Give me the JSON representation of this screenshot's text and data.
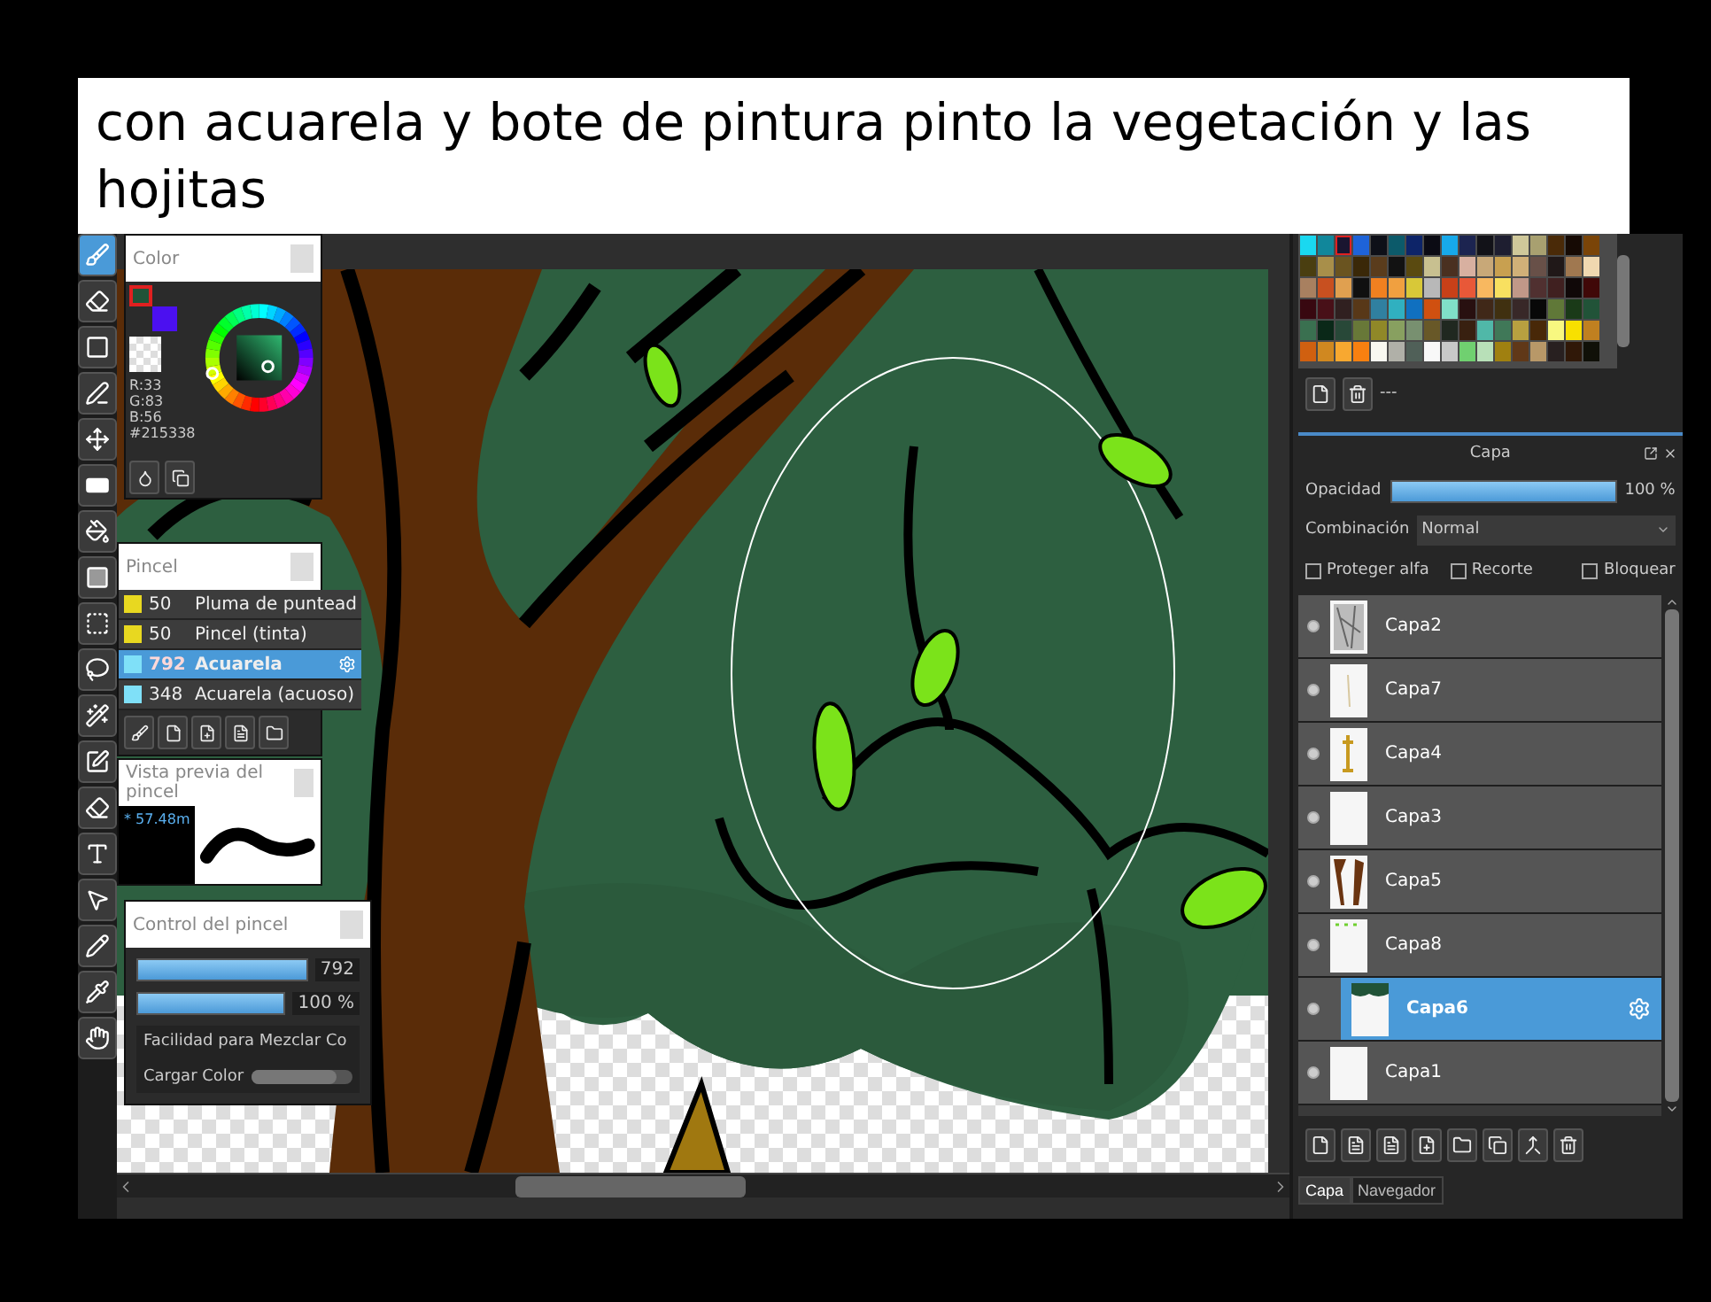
{
  "caption": "con acuarela y bote de pintura pinto  la vegetación y las hojitas",
  "tools": [
    {
      "kind": "brush",
      "selected": true
    },
    {
      "kind": "eraser",
      "selected": false
    },
    {
      "kind": "rect",
      "selected": false
    },
    {
      "kind": "pen",
      "selected": false
    },
    {
      "kind": "move",
      "selected": false
    },
    {
      "kind": "fill-rect",
      "selected": false
    },
    {
      "kind": "bucket",
      "selected": false
    },
    {
      "kind": "gradient",
      "selected": false
    },
    {
      "kind": "select",
      "selected": false
    },
    {
      "kind": "lasso",
      "selected": false
    },
    {
      "kind": "wand",
      "selected": false
    },
    {
      "kind": "select-pen",
      "selected": false
    },
    {
      "kind": "select-eraser",
      "selected": false
    },
    {
      "kind": "text",
      "selected": false
    },
    {
      "kind": "operation",
      "selected": false
    },
    {
      "kind": "divide",
      "selected": false
    },
    {
      "kind": "eyedropper",
      "selected": false
    },
    {
      "kind": "hand",
      "selected": false
    }
  ],
  "color_panel": {
    "title": "Color",
    "values": [
      "R:33",
      "G:83",
      "B:56"
    ],
    "hex": "#215338"
  },
  "brush_panel": {
    "title": "Pincel",
    "brushes": [
      {
        "size": "50",
        "name": "Pluma de puntead",
        "color": "#e8d820",
        "selected": false
      },
      {
        "size": "50",
        "name": "Pincel (tinta)",
        "color": "#e8d820",
        "selected": false
      },
      {
        "size": "792",
        "name": "Acuarela",
        "color": "#7fe0f8",
        "selected": true
      },
      {
        "size": "348",
        "name": "Acuarela (acuoso)",
        "color": "#7fe0f8",
        "selected": false
      }
    ]
  },
  "preview_panel": {
    "title": "Vista previa del pincel",
    "size": "* 57.48m"
  },
  "control_panel": {
    "title": "Control del pincel",
    "sliders": [
      {
        "level": 1,
        "reading": "792"
      },
      {
        "level": 1,
        "reading": "100 %"
      }
    ],
    "options": [
      {
        "label": "Facilidad para Mezclar Co"
      },
      {
        "label": "Cargar Color",
        "level": 0.85
      }
    ]
  },
  "palette": {
    "swatches": [
      {
        "color": "#1ad8f0",
        "selected": false
      },
      {
        "color": "#11879b",
        "selected": false
      },
      {
        "color": "#1a1530",
        "selected": true
      },
      {
        "color": "#1e63d8",
        "selected": false
      },
      {
        "color": "#0e1018",
        "selected": false
      },
      {
        "color": "#0c5a6a",
        "selected": false
      },
      {
        "color": "#0d2468",
        "selected": false
      },
      {
        "color": "#0b0b14",
        "selected": false
      },
      {
        "color": "#17a9ea",
        "selected": false
      },
      {
        "color": "#1c2450",
        "selected": false
      },
      {
        "color": "#121218",
        "selected": false
      },
      {
        "color": "#1e1e30",
        "selected": false
      },
      {
        "color": "#cfc89a",
        "selected": false
      },
      {
        "color": "#a8a070",
        "selected": false
      },
      {
        "color": "#4a2a08",
        "selected": false
      },
      {
        "color": "#160a04",
        "selected": false
      },
      {
        "color": "#7a4408",
        "selected": false
      },
      {
        "color": "#4a3e10",
        "selected": false
      },
      {
        "color": "#a88f4a",
        "selected": false
      },
      {
        "color": "#6a5420",
        "selected": false
      },
      {
        "color": "#3a2808",
        "selected": false
      },
      {
        "color": "#5a3c1c",
        "selected": false
      },
      {
        "color": "#121212",
        "selected": false
      },
      {
        "color": "#5a4a10",
        "selected": false
      },
      {
        "color": "#c8c090",
        "selected": false
      },
      {
        "color": "#4a3020",
        "selected": false
      },
      {
        "color": "#d8b0a0",
        "selected": false
      },
      {
        "color": "#c8a878",
        "selected": false
      },
      {
        "color": "#c8a050",
        "selected": false
      },
      {
        "color": "#d0b078",
        "selected": false
      },
      {
        "color": "#685048",
        "selected": false
      },
      {
        "color": "#201818",
        "selected": false
      },
      {
        "color": "#a07850",
        "selected": false
      },
      {
        "color": "#f0d8b0",
        "selected": false
      },
      {
        "color": "#a88060",
        "selected": false
      },
      {
        "color": "#c85020",
        "selected": false
      },
      {
        "color": "#e0a050",
        "selected": false
      },
      {
        "color": "#101010",
        "selected": false
      },
      {
        "color": "#f08020",
        "selected": false
      },
      {
        "color": "#f0a040",
        "selected": false
      },
      {
        "color": "#d8c838",
        "selected": false
      },
      {
        "color": "#b8b8b8",
        "selected": false
      },
      {
        "color": "#c84018",
        "selected": false
      },
      {
        "color": "#e85838",
        "selected": false
      },
      {
        "color": "#f8b860",
        "selected": false
      },
      {
        "color": "#f8e060",
        "selected": false
      },
      {
        "color": "#c09888",
        "selected": false
      },
      {
        "color": "#503030",
        "selected": false
      },
      {
        "color": "#402020",
        "selected": false
      },
      {
        "color": "#100808",
        "selected": false
      },
      {
        "color": "#400808",
        "selected": false
      },
      {
        "color": "#380810",
        "selected": false
      },
      {
        "color": "#481018",
        "selected": false
      },
      {
        "color": "#302020",
        "selected": false
      },
      {
        "color": "#583818",
        "selected": false
      },
      {
        "color": "#3080a0",
        "selected": false
      },
      {
        "color": "#30b0c0",
        "selected": false
      },
      {
        "color": "#1070c0",
        "selected": false
      },
      {
        "color": "#d05010",
        "selected": false
      },
      {
        "color": "#80e0c8",
        "selected": false
      },
      {
        "color": "#281010",
        "selected": false
      },
      {
        "color": "#402818",
        "selected": false
      },
      {
        "color": "#403010",
        "selected": false
      },
      {
        "color": "#382828",
        "selected": false
      },
      {
        "color": "#080808",
        "selected": false
      },
      {
        "color": "#607838",
        "selected": false
      },
      {
        "color": "#1a3a18",
        "selected": false
      },
      {
        "color": "#215338",
        "selected": false
      },
      {
        "color": "#3a7050",
        "selected": false
      },
      {
        "color": "#0a2818",
        "selected": false
      },
      {
        "color": "#284838",
        "selected": false
      },
      {
        "color": "#687838",
        "selected": false
      },
      {
        "color": "#908828",
        "selected": false
      },
      {
        "color": "#88a060",
        "selected": false
      },
      {
        "color": "#789070",
        "selected": false
      },
      {
        "color": "#685828",
        "selected": false
      },
      {
        "color": "#202820",
        "selected": false
      },
      {
        "color": "#382010",
        "selected": false
      },
      {
        "color": "#50b8a8",
        "selected": false
      },
      {
        "color": "#407858",
        "selected": false
      },
      {
        "color": "#b8a040",
        "selected": false
      },
      {
        "color": "#482808",
        "selected": false
      },
      {
        "color": "#f8f880",
        "selected": false
      },
      {
        "color": "#f8e000",
        "selected": false
      },
      {
        "color": "#c08020",
        "selected": false
      },
      {
        "color": "#d06010",
        "selected": false
      },
      {
        "color": "#d08820",
        "selected": false
      },
      {
        "color": "#f8a830",
        "selected": false
      },
      {
        "color": "#f88010",
        "selected": false
      },
      {
        "color": "#f8f8f0",
        "selected": false
      },
      {
        "color": "#b0b0a8",
        "selected": false
      },
      {
        "color": "#506058",
        "selected": false
      },
      {
        "color": "#f8f8f8",
        "selected": false
      },
      {
        "color": "#c8c8c8",
        "selected": false
      },
      {
        "color": "#70d070",
        "selected": false
      },
      {
        "color": "#b8e0b8",
        "selected": false
      },
      {
        "color": "#a08010",
        "selected": false
      },
      {
        "color": "#603818",
        "selected": false
      },
      {
        "color": "#b89868",
        "selected": false
      },
      {
        "color": "#282020",
        "selected": false
      },
      {
        "color": "#301808",
        "selected": false
      },
      {
        "color": "#101008",
        "selected": false
      }
    ],
    "status": "---"
  },
  "layer_panel": {
    "title": "Capa",
    "opacity_label": "Opacidad",
    "opacity": {
      "level": 1,
      "reading": "100 %"
    },
    "blend_label": "Combinación",
    "blend": "Normal",
    "options": [
      {
        "label": "Proteger alfa",
        "checked": false
      },
      {
        "label": "Recorte",
        "checked": false
      },
      {
        "label": "Bloquear",
        "checked": false
      }
    ],
    "layers": [
      {
        "name": "Capa2",
        "kind": "sketch",
        "visible": true,
        "selected": false
      },
      {
        "name": "Capa7",
        "kind": "faint",
        "visible": true,
        "selected": false
      },
      {
        "name": "Capa4",
        "kind": "figure",
        "visible": true,
        "selected": false
      },
      {
        "name": "Capa3",
        "kind": "empty",
        "visible": true,
        "selected": false
      },
      {
        "name": "Capa5",
        "kind": "trees",
        "visible": true,
        "selected": false
      },
      {
        "name": "Capa8",
        "kind": "leaves",
        "visible": true,
        "selected": false
      },
      {
        "name": "Capa6",
        "kind": "foliage",
        "visible": true,
        "selected": true
      },
      {
        "name": "Capa1",
        "kind": "empty",
        "visible": true,
        "selected": false
      }
    ]
  },
  "bottom_tabs": [
    {
      "label": "Capa",
      "selected": true
    },
    {
      "label": "Navegador",
      "selected": false
    }
  ]
}
